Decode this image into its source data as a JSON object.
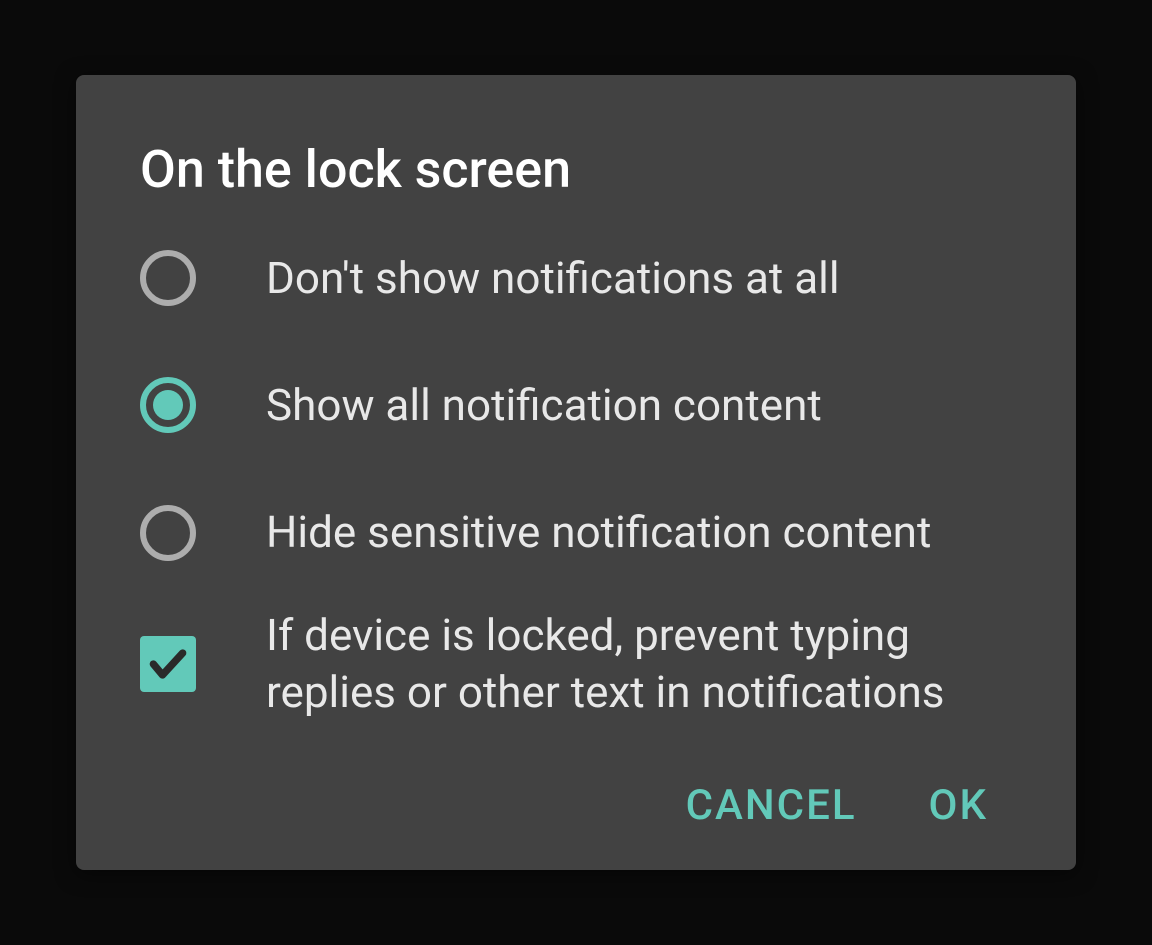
{
  "dialog": {
    "title": "On the lock screen",
    "options": [
      {
        "label": "Don't show notifications at all",
        "selected": false
      },
      {
        "label": "Show all notification content",
        "selected": true
      },
      {
        "label": "Hide sensitive notification content",
        "selected": false
      }
    ],
    "checkbox": {
      "label": "If device is locked, prevent typing replies or other text in notifications",
      "checked": true
    },
    "buttons": {
      "cancel": "CANCEL",
      "ok": "OK"
    }
  },
  "colors": {
    "accent": "#62c9b9",
    "dialog_bg": "#424242",
    "page_bg": "#0a0a0a",
    "text_primary": "#ffffff",
    "text_secondary": "#e8e8e8",
    "radio_unselected": "#adadad"
  }
}
